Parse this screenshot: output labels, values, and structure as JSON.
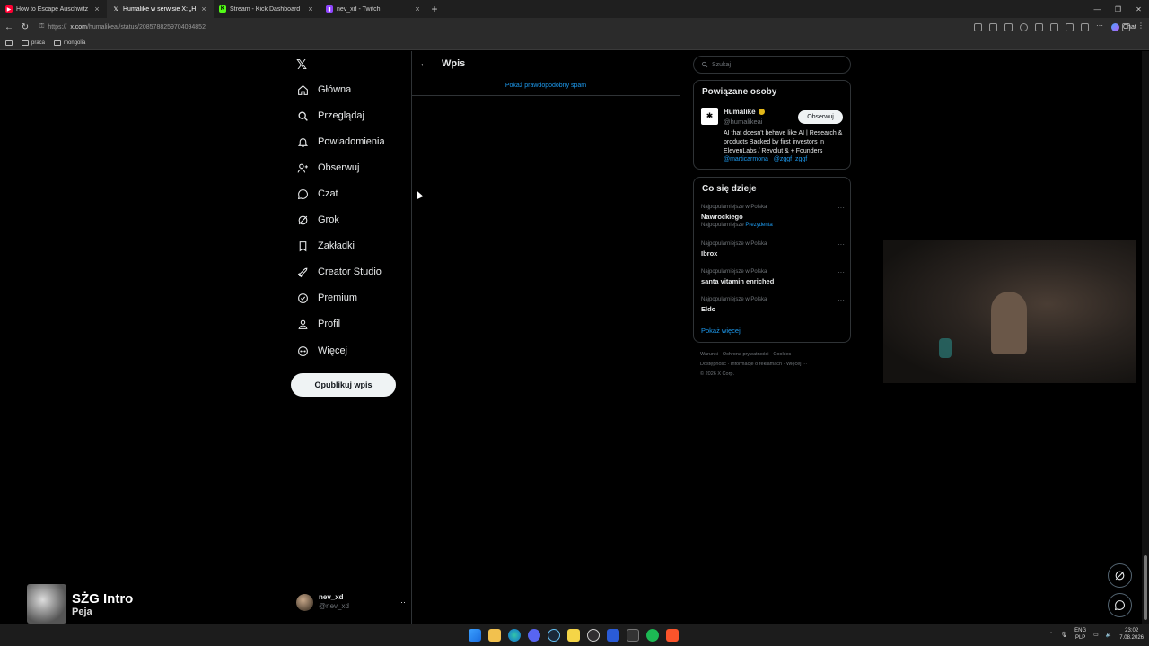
{
  "browser": {
    "tabs": [
      {
        "title": "How to Escape Auschwitz - YouTu",
        "favicon_color": "#ff0033",
        "active": false
      },
      {
        "title": "Humalike w serwisie X: „Humalike",
        "favicon_color": "#ffffff",
        "active": true
      },
      {
        "title": "Stream - Kick Dashboard",
        "favicon_color": "#53fc18",
        "active": false
      },
      {
        "title": "nev_xd - Twitch",
        "favicon_color": "#9146ff",
        "active": false
      }
    ],
    "url_prefix": "https://",
    "url_domain": "x.com",
    "url_path": "/humalikeai/status/2085788259704094852",
    "chat_label": "Chat",
    "bookmarks": [
      "praca",
      "mongolia"
    ]
  },
  "sidebar": {
    "items": [
      {
        "label": "Główna",
        "icon": "home-icon"
      },
      {
        "label": "Przeglądaj",
        "icon": "search-icon"
      },
      {
        "label": "Powiadomienia",
        "icon": "bell-icon"
      },
      {
        "label": "Obserwuj",
        "icon": "follow-icon"
      },
      {
        "label": "Czat",
        "icon": "chat-icon"
      },
      {
        "label": "Grok",
        "icon": "grok-icon"
      },
      {
        "label": "Zakładki",
        "icon": "bookmark-icon"
      },
      {
        "label": "Creator Studio",
        "icon": "rocket-icon"
      },
      {
        "label": "Premium",
        "icon": "premium-icon"
      },
      {
        "label": "Profil",
        "icon": "profile-icon"
      },
      {
        "label": "Więcej",
        "icon": "more-icon"
      }
    ],
    "post_button": "Opublikuj wpis",
    "account": {
      "name": "nev_xd",
      "handle": "@nev_xd"
    }
  },
  "main": {
    "title": "Wpis",
    "spam_link": "Pokaż prawdopodobny spam"
  },
  "right": {
    "search_placeholder": "Szukaj",
    "related": {
      "title": "Powiązane osoby",
      "name": "Humalike",
      "handle": "@humalikeai",
      "follow_label": "Obserwuj",
      "bio": "AI that doesn't behave like AI | Research & products Backed by first investors in ElevenLabs / Revolut & + Founders ",
      "bio_links": "@marticarmona_ @zggf_zggf"
    },
    "trends": {
      "title": "Co się dzieje",
      "items": [
        {
          "meta": "Najpopularniejsze w Polska",
          "name": "Nawrockiego",
          "sub_prefix": "Najpopularniejsze ",
          "sub_link": "Prezydenta"
        },
        {
          "meta": "Najpopularniejsze w Polska",
          "name": "Ibrox"
        },
        {
          "meta": "Najpopularniejsze w Polska",
          "name": "santa vitamin enriched"
        },
        {
          "meta": "Najpopularniejsze w Polska",
          "name": "Eldo"
        }
      ],
      "show_more": "Pokaż więcej"
    },
    "footer": {
      "line1": "Warunki · Ochrona prywatności · Cookies ·",
      "line2": "Dostępność · Informacje o reklamach · Więcej ···",
      "line3": "© 2026 X Corp."
    }
  },
  "overlay": {
    "music_title": "SŻG Intro",
    "music_artist": "Peja"
  },
  "taskbar": {
    "lang_top": "ENG",
    "lang_bottom": "PLP",
    "time": "23:02",
    "date": "7.08.2026"
  },
  "colors": {
    "accent": "#1d9bf0",
    "background": "#000000",
    "border": "#2f3336",
    "muted": "#71767b"
  }
}
